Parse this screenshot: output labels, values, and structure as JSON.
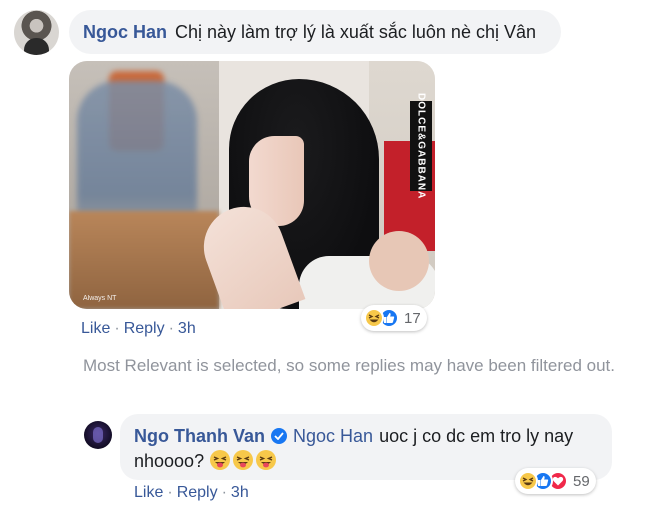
{
  "main_comment": {
    "author": "Ngoc Han",
    "text": "Chị này làm trợ lý là xuất sắc luôn nè chị Vân",
    "photo_brand_tag": "DOLCE&GABBANA",
    "photo_watermark": "Always NT",
    "actions": {
      "like": "Like",
      "reply": "Reply",
      "separator": "·",
      "time": "3h"
    },
    "reactions": {
      "types": [
        "haha-icon",
        "like-icon"
      ],
      "count": "17"
    }
  },
  "filter_notice": "Most Relevant is selected, so some replies may have been filtered out.",
  "reply": {
    "author": "Ngo Thanh Van",
    "verified": true,
    "mention": "Ngoc Han",
    "text": "uoc j co dc em tro ly nay nhoooo?",
    "emojis": [
      "tongue-out-icon",
      "tongue-out-icon",
      "tongue-out-icon"
    ],
    "actions": {
      "like": "Like",
      "reply": "Reply",
      "separator": "·",
      "time": "3h"
    },
    "reactions": {
      "types": [
        "haha-icon",
        "like-icon",
        "love-icon"
      ],
      "count": "59"
    }
  },
  "colors": {
    "link": "#385898",
    "bubble": "#f2f3f5",
    "muted": "#8d949e",
    "like": "#1877f2",
    "love": "#f0284a",
    "haha": "#f7c84a"
  }
}
